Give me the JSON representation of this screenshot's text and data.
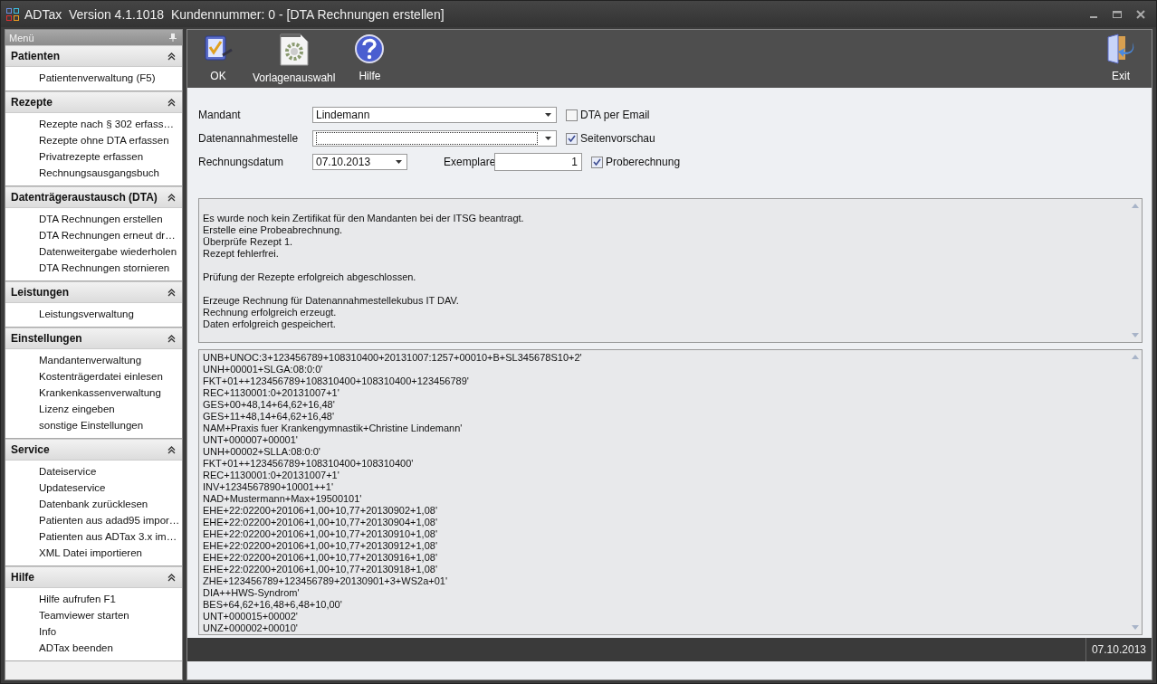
{
  "window": {
    "title": "ADTax  Version 4.1.1018  Kundennummer: 0 - [DTA Rechnungen erstellen]"
  },
  "sidebar": {
    "title": "Menü",
    "sections": [
      {
        "title": "Patienten",
        "expanded": true,
        "items": [
          "Patientenverwaltung (F5)"
        ]
      },
      {
        "title": "Rezepte",
        "expanded": true,
        "items": [
          "Rezepte nach § 302 erfass…",
          "Rezepte ohne DTA erfassen",
          "Privatrezepte erfassen",
          "Rechnungsausgangsbuch"
        ]
      },
      {
        "title": "Datenträgeraustausch (DTA)",
        "expanded": true,
        "items": [
          "DTA Rechnungen erstellen",
          "DTA Rechnungen erneut dr…",
          "Datenweitergabe wiederholen",
          "DTA Rechnungen stornieren"
        ]
      },
      {
        "title": "Leistungen",
        "expanded": true,
        "items": [
          "Leistungsverwaltung"
        ]
      },
      {
        "title": "Einstellungen",
        "expanded": true,
        "items": [
          "Mandantenverwaltung",
          "Kostenträgerdatei einlesen",
          "Krankenkassenverwaltung",
          "Lizenz eingeben",
          "sonstige Einstellungen"
        ]
      },
      {
        "title": "Service",
        "expanded": true,
        "items": [
          "Dateiservice",
          "Updateservice",
          "Datenbank zurücklesen",
          "Patienten aus adad95 impor…",
          "Patienten aus ADTax 3.x im…",
          "XML Datei  importieren"
        ]
      },
      {
        "title": "Hilfe",
        "expanded": true,
        "items": [
          "Hilfe aufrufen F1",
          "Teamviewer starten",
          "Info",
          "ADTax beenden"
        ]
      }
    ]
  },
  "toolbar": [
    {
      "kind": "ok",
      "label": "OK"
    },
    {
      "kind": "template",
      "label": "Vorlagenauswahl"
    },
    {
      "kind": "help",
      "label": "Hilfe"
    }
  ],
  "toolbar_right": [
    {
      "kind": "exit",
      "label": "Exit"
    }
  ],
  "form": {
    "mandant": {
      "label": "Mandant",
      "value": "Lindemann"
    },
    "datenannahmestelle": {
      "label": "Datenannahmestelle"
    },
    "rechnungsdatum": {
      "label": "Rechnungsdatum",
      "value": "07.10.2013"
    },
    "exemplare": {
      "label": "Exemplare",
      "value": "1"
    },
    "checkboxes": [
      {
        "label": "DTA per Email",
        "checked": false
      },
      {
        "label": "Seitenvorschau",
        "checked": true
      },
      {
        "label": "Proberechnung",
        "checked": true
      }
    ]
  },
  "log": [
    [
      "Es wurde noch kein Zertifikat für den Mandanten bei der ITSG beantragt.",
      "Erstelle eine Probeabrechnung.",
      "Überprüfe Rezept 1.",
      "Rezept fehlerfrei."
    ],
    [
      "Prüfung der Rezepte erfolgreich abgeschlossen."
    ],
    [
      "Erzeuge Rechnung für Datenannahmestellekubus IT DAV.",
      "Rechnung erfolgreich erzeugt.",
      "Daten erfolgreich gespeichert."
    ]
  ],
  "edi": [
    "UNB+UNOC:3+123456789+108310400+20131007:1257+00010+B+SL345678S10+2'",
    "UNH+00001+SLGA:08:0:0'",
    "FKT+01++123456789+108310400+108310400+123456789'",
    "REC+1130001:0+20131007+1'",
    "GES+00+48,14+64,62+16,48'",
    "GES+11+48,14+64,62+16,48'",
    "NAM+Praxis fuer Krankengymnastik+Christine Lindemann'",
    "UNT+000007+00001'",
    "UNH+00002+SLLA:08:0:0'",
    "FKT+01++123456789+108310400+108310400'",
    "REC+1130001:0+20131007+1'",
    "INV+1234567890+10001++1'",
    "NAD+Mustermann+Max+19500101'",
    "EHE+22:02200+20106+1,00+10,77+20130902+1,08'",
    "EHE+22:02200+20106+1,00+10,77+20130904+1,08'",
    "EHE+22:02200+20106+1,00+10,77+20130910+1,08'",
    "EHE+22:02200+20106+1,00+10,77+20130912+1,08'",
    "EHE+22:02200+20106+1,00+10,77+20130916+1,08'",
    "EHE+22:02200+20106+1,00+10,77+20130918+1,08'",
    "ZHE+123456789+123456789+20130901+3+WS2a+01'",
    "DIA++HWS-Syndrom'",
    "BES+64,62+16,48+6,48+10,00'",
    "UNT+000015+00002'",
    "UNZ+000002+00010'"
  ],
  "status_bar": {
    "date": "07.10.2013"
  }
}
